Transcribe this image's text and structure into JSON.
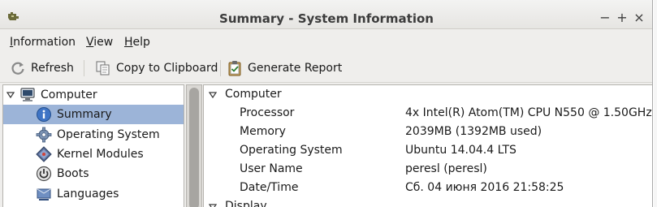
{
  "window": {
    "title": "Summary - System Information",
    "controls": [
      "−",
      "+",
      "×"
    ]
  },
  "menubar": {
    "items": [
      {
        "label_pre": "",
        "label_u": "I",
        "label_post": "nformation"
      },
      {
        "label_pre": "",
        "label_u": "V",
        "label_post": "iew"
      },
      {
        "label_pre": "",
        "label_u": "H",
        "label_post": "elp"
      }
    ]
  },
  "toolbar": {
    "refresh_label": "Refresh",
    "copy_label": "Copy to Clipboard",
    "report_label": "Generate Report"
  },
  "tree": {
    "root_label": "Computer",
    "items": [
      {
        "label": "Summary",
        "icon": "info-icon",
        "selected": true
      },
      {
        "label": "Operating System",
        "icon": "gear-icon",
        "selected": false
      },
      {
        "label": "Kernel Modules",
        "icon": "kernel-module-icon",
        "selected": false
      },
      {
        "label": "Boots",
        "icon": "power-icon",
        "selected": false
      },
      {
        "label": "Languages",
        "icon": "languages-icon",
        "selected": false
      }
    ]
  },
  "details": {
    "section_computer": "Computer",
    "rows": [
      {
        "key": "Processor",
        "value": "4x Intel(R) Atom(TM) CPU N550   @ 1.50GHz"
      },
      {
        "key": "Memory",
        "value": "2039MB (1392MB used)"
      },
      {
        "key": "Operating System",
        "value": "Ubuntu 14.04.4 LTS"
      },
      {
        "key": "User Name",
        "value": "peresl (peresl)"
      },
      {
        "key": "Date/Time",
        "value": "Сб. 04 июня 2016 21:58:25"
      }
    ],
    "section_display": "Display"
  },
  "colors": {
    "selection": "#9cb4d8",
    "window_bg": "#efeeec"
  }
}
